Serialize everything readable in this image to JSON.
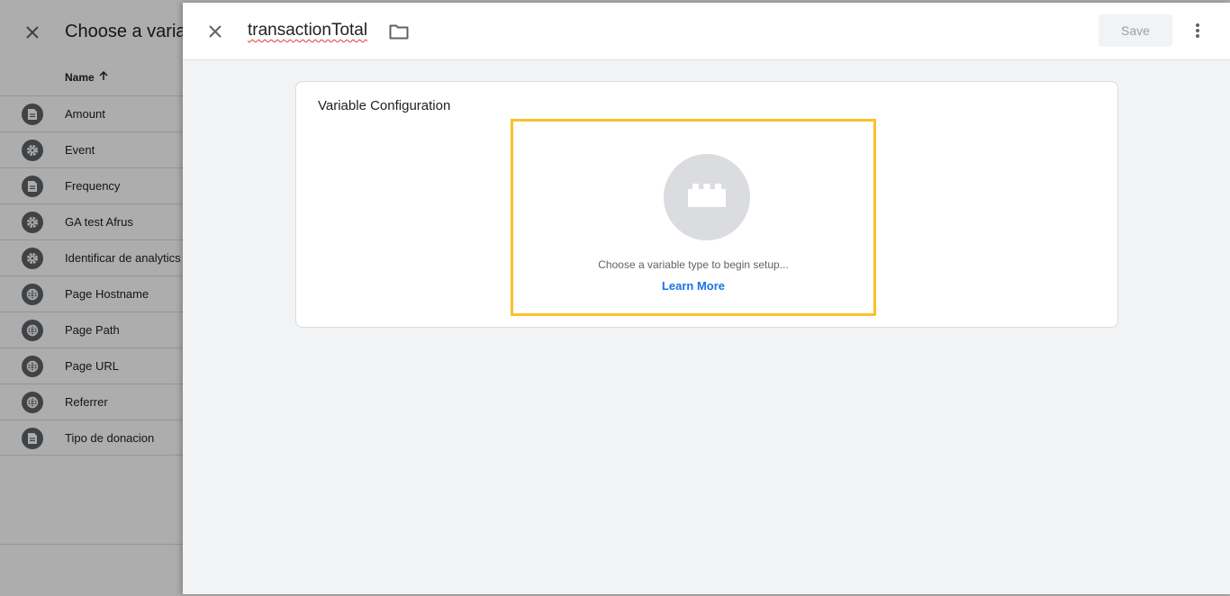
{
  "variable_list": {
    "title": "Choose a variable",
    "column_header": "Name",
    "items": [
      {
        "label": "Amount",
        "icon": "document-icon"
      },
      {
        "label": "Event",
        "icon": "gear-icon"
      },
      {
        "label": "Frequency",
        "icon": "document-icon"
      },
      {
        "label": "GA test Afrus",
        "icon": "gear-icon"
      },
      {
        "label": "Identificar de analytics",
        "icon": "gear-icon"
      },
      {
        "label": "Page Hostname",
        "icon": "globe-icon"
      },
      {
        "label": "Page Path",
        "icon": "globe-icon"
      },
      {
        "label": "Page URL",
        "icon": "globe-icon"
      },
      {
        "label": "Referrer",
        "icon": "globe-icon"
      },
      {
        "label": "Tipo de donacion",
        "icon": "document-icon"
      }
    ]
  },
  "editor": {
    "variable_name": "transactionTotal",
    "save_label": "Save",
    "config_title": "Variable Configuration",
    "chooser_text": "Choose a variable type to begin setup...",
    "learn_more": "Learn More"
  },
  "colors": {
    "highlight": "#fbc02d",
    "link": "#1a73e8",
    "icon_bg": "#5f6368"
  }
}
